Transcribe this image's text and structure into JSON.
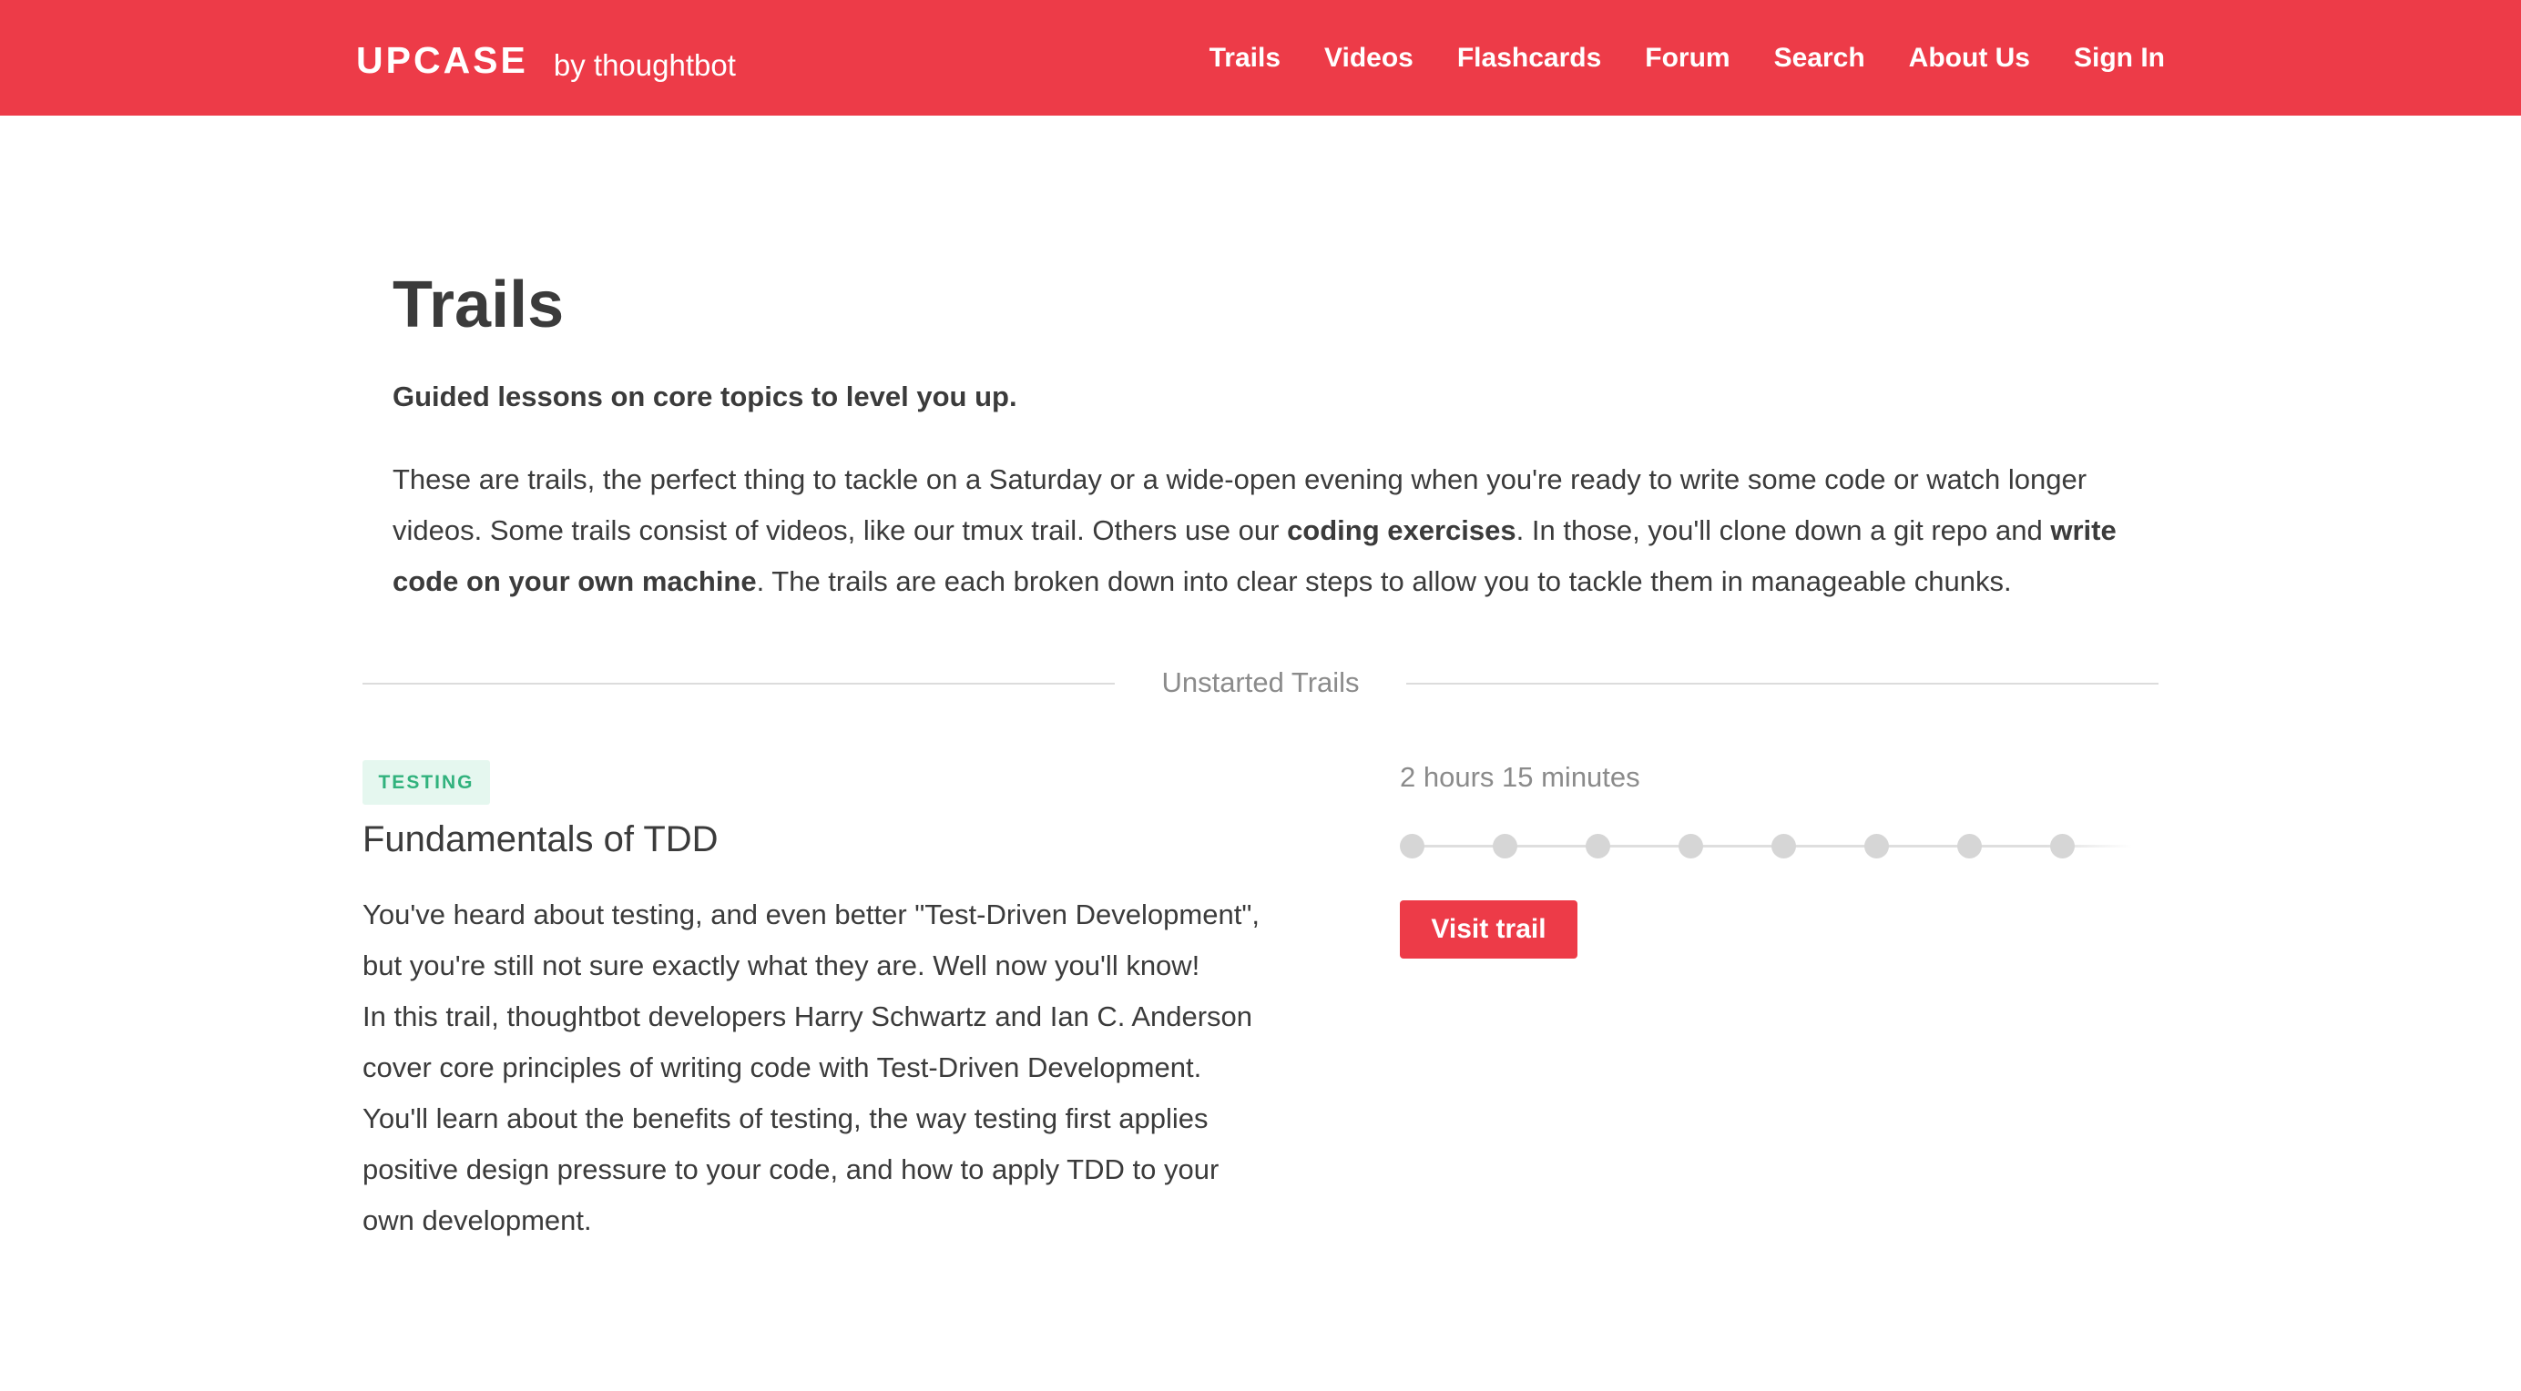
{
  "header": {
    "logo_text": "UPCASE",
    "logo_byline": "by thoughtbot",
    "nav": [
      {
        "label": "Trails"
      },
      {
        "label": "Videos"
      },
      {
        "label": "Flashcards"
      },
      {
        "label": "Forum"
      },
      {
        "label": "Search"
      },
      {
        "label": "About Us"
      },
      {
        "label": "Sign In"
      }
    ]
  },
  "intro": {
    "title": "Trails",
    "tagline": "Guided lessons on core topics to level you up.",
    "paragraph": {
      "t1": "These are trails, the perfect thing to tackle on a Saturday or a wide-open evening when you're ready to write some code or watch longer videos. Some trails consist of videos, like our tmux trail. Others use our ",
      "b1": "coding exercises",
      "t2": ". In those, you'll clone down a git repo and ",
      "b2": "write code on your own machine",
      "t3": ". The trails are each broken down into clear steps to allow you to tackle them in manageable chunks."
    }
  },
  "section": {
    "divider_label": "Unstarted Trails"
  },
  "trail": {
    "badge": "TESTING",
    "title": "Fundamentals of TDD",
    "description_1": "You've heard about testing, and even better \"Test-Driven Development\", but you're still not sure exactly what they are. Well now you'll know!",
    "description_2": "In this trail, thoughtbot developers Harry Schwartz and Ian C. Anderson cover core principles of writing code with Test-Driven Development. You'll learn about the benefits of testing, the way testing first applies positive design pressure to your code, and how to apply TDD to your own development.",
    "duration": "2 hours 15 minutes",
    "steps_total": 8,
    "steps_completed": 0,
    "button_label": "Visit trail"
  },
  "colors": {
    "brand_red": "#ed3b48",
    "badge_bg": "#e5f7ef",
    "badge_text": "#31b27d",
    "step_dot": "#d6d6d6"
  }
}
